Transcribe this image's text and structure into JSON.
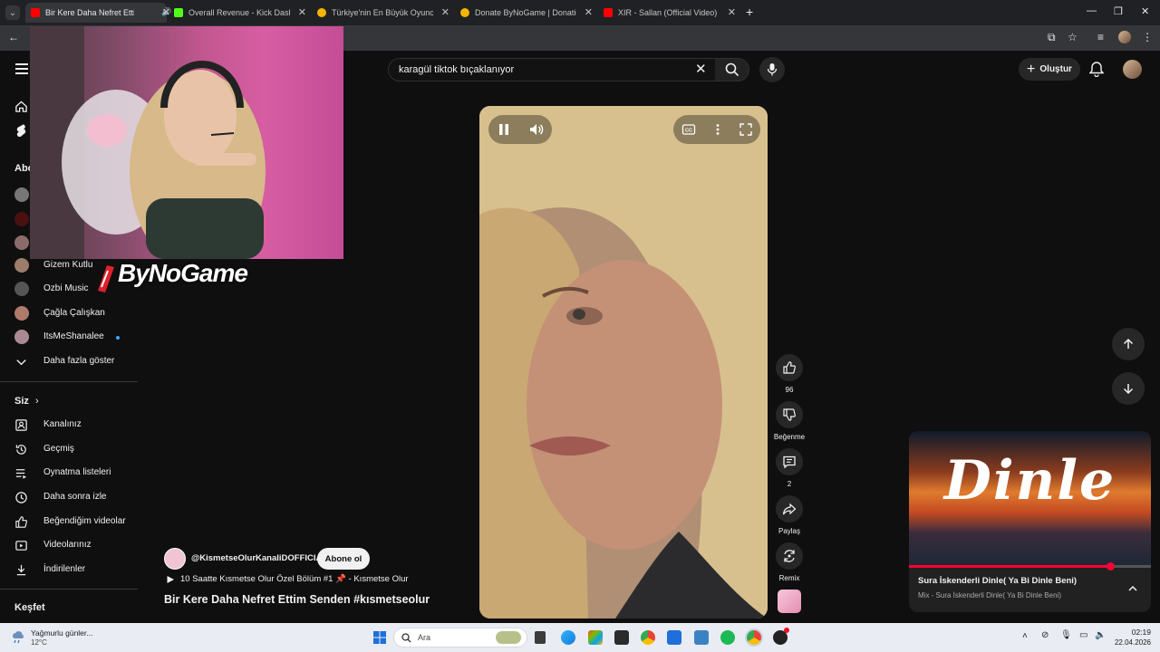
{
  "browser": {
    "tabs": [
      {
        "title": "Bir Kere Daha Nefret Ettim",
        "active": true,
        "favicon_color": "#ff0000"
      },
      {
        "title": "Overall Revenue - Kick Dashbo",
        "active": false,
        "favicon_color": "#53fc18"
      },
      {
        "title": "Türkiye'nin En Büyük Oyuncu D",
        "active": false,
        "favicon_color": "#f4b400"
      },
      {
        "title": "Donate ByNoGame | Donations",
        "active": false,
        "favicon_color": "#f4b400"
      },
      {
        "title": "XIR - Sallan (Official Video) - Yo",
        "active": false,
        "favicon_color": "#ff0000"
      }
    ],
    "new_tab_icon": "plus-icon"
  },
  "header": {
    "search_value": "karagül tiktok bıçaklanıyor",
    "create_label": "Oluştur"
  },
  "sidebar": {
    "subscriptions_heading": "Abo",
    "channels": [
      {
        "name": "Gizem Kutlu",
        "avatar_color": "#9b7d6a"
      },
      {
        "name": "Ozbi Music",
        "avatar_color": "#555555"
      },
      {
        "name": "Çağla Çalışkan",
        "avatar_color": "#b07a6a"
      },
      {
        "name": "ItsMeShanalee",
        "avatar_color": "#a98a93",
        "live_dot": true
      }
    ],
    "show_more": "Daha fazla göster",
    "you_heading": "Siz",
    "you_items": [
      {
        "label": "Kanalınız",
        "icon": "channel-icon"
      },
      {
        "label": "Geçmiş",
        "icon": "history-icon"
      },
      {
        "label": "Oynatma listeleri",
        "icon": "playlist-icon"
      },
      {
        "label": "Daha sonra izle",
        "icon": "clock-icon"
      },
      {
        "label": "Beğendiğim videolar",
        "icon": "thumbs-up-icon"
      },
      {
        "label": "Videolarınız",
        "icon": "video-icon"
      },
      {
        "label": "İndirilenler",
        "icon": "download-icon"
      }
    ],
    "explore_heading": "Keşfet"
  },
  "overlay": {
    "brand": "ByNoGame"
  },
  "short": {
    "channel_handle": "@KismetseOlurKanaliDOFFICIAL",
    "subscribe_label": "Abone ol",
    "playlist_link": "10 Saatte Kısmetse Olur Özel Bölüm #1 📌 - Kısmetse Olur",
    "title": "Bir Kere Daha Nefret Ettim Senden #kısmetseolur",
    "likes": "96",
    "dislike_label": "Beğenme",
    "comments": "2",
    "share_label": "Paylaş",
    "remix_label": "Remix"
  },
  "mix_card": {
    "thumb_word": "Dinle",
    "title": "Sura İskenderli Dinle( Ya Bi Dinle Beni)",
    "subtitle": "Mix - Sura İskenderli Dinle( Ya Bi Dinle Beni)",
    "progress": 0.83
  },
  "taskbar": {
    "weather_text": "Yağmurlu günler...",
    "temperature": "12°C",
    "search_placeholder": "Ara",
    "time": "02:19",
    "date": "22.04.2026"
  }
}
